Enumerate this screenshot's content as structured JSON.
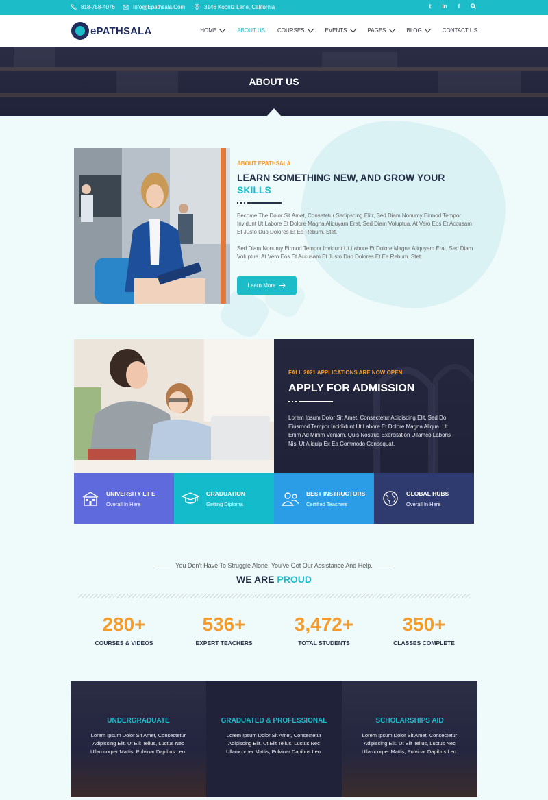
{
  "topbar": {
    "phone": "818-758-4076",
    "email": "Info@Epathsala.Com",
    "address": "3146 Koontz Lane, California",
    "socials": [
      "twitter-icon",
      "linkedin-icon",
      "facebook-icon",
      "search-icon"
    ]
  },
  "header": {
    "logo_text": "ePATHSALA",
    "nav": [
      {
        "label": "HOME",
        "dropdown": true
      },
      {
        "label": "ABOUT US",
        "dropdown": false,
        "active": true
      },
      {
        "label": "COURSES",
        "dropdown": true
      },
      {
        "label": "EVENTS",
        "dropdown": true
      },
      {
        "label": "PAGES",
        "dropdown": true
      },
      {
        "label": "BLOG",
        "dropdown": true
      },
      {
        "label": "CONTACT US",
        "dropdown": false
      }
    ]
  },
  "hero": {
    "title": "ABOUT US"
  },
  "about": {
    "kicker": "ABOUT EPATHSALA",
    "title_main": "LEARN SOMETHING NEW, AND GROW YOUR",
    "title_highlight": "SKILLS",
    "para1": "Become The Dolor Sit Amet, Consetetur Sadipscing Elitr, Sed Diam Nonumy Eirmod Tempor Invidunt Ut Labore Et Dolore Magna Aliquyam Erat, Sed Diam Voluptua. At Vero Eos Et Accusam Et Justo Duo Dolores Et Ea Rebum. Stet.",
    "para2": "Sed Diam Nonumy Eirmod Tempor Invidunt Ut Labore Et Dolore Magna Aliquyam Erat, Sed Diam Voluptua. At Vero Eos Et Accusam Et Justo Duo Dolores Et Ea Rebum. Stet.",
    "button_label": "Learn More"
  },
  "admission": {
    "kicker": "FALL 2021 APPLICATIONS ARE NOW OPEN",
    "title": "APPLY FOR ADMISSION",
    "text": "Lorem Ipsum Dolor Sit Amet, Consectetur Adipiscing Elit, Sed Do Eiusmod Tempor Incididunt Ut Labore Et Dolore Magna Aliqua. Ut Enim Ad Minim Veniam, Quis Nostrud Exercitation Ullamco Laboris Nisi Ut Aliquip Ex Ea Commodo Consequat.",
    "features": [
      {
        "title": "UNIVERSITY LIFE",
        "subtitle": "Overall In Here",
        "icon": "university-icon",
        "color": "#5f6bdc"
      },
      {
        "title": "GRADUATION",
        "subtitle": "Getting Diploma",
        "icon": "graduation-cap-icon",
        "color": "#14bccb"
      },
      {
        "title": "BEST INSTRUCTORS",
        "subtitle": "Certified Teachers",
        "icon": "instructors-icon",
        "color": "#2b9de6"
      },
      {
        "title": "GLOBAL HUBS",
        "subtitle": "Overall In Here",
        "icon": "globe-icon",
        "color": "#2f3a6f"
      }
    ]
  },
  "proud": {
    "subtitle": "You Don't Have To Struggle Alone, You've Got Our Assistance And Help.",
    "title_main": "WE ARE",
    "title_highlight": "PROUD",
    "stats": [
      {
        "number": "280+",
        "label": "COURSES & VIDEOS"
      },
      {
        "number": "536+",
        "label": "EXPERT TEACHERS"
      },
      {
        "number": "3,472+",
        "label": "TOTAL STUDENTS"
      },
      {
        "number": "350+",
        "label": "CLASSES COMPLETE"
      }
    ]
  },
  "programs": [
    {
      "title": "UNDERGRADUATE",
      "text": "Lorem Ipsum Dolor Sit Amet, Consectetur Adipiscing Elit. Ut Elit Tellus, Luctus Nec Ullamcorper Mattis, Pulvinar Dapibus Leo."
    },
    {
      "title": "GRADUATED & PROFESSIONAL",
      "text": "Lorem Ipsum Dolor Sit Amet, Consectetur Adipiscing Elit. Ut Elit Tellus, Luctus Nec Ullamcorper Mattis, Pulvinar Dapibus Leo."
    },
    {
      "title": "SCHOLARSHIPS AID",
      "text": "Lorem Ipsum Dolor Sit Amet, Consectetur Adipiscing Elit. Ut Elit Tellus, Luctus Nec Ullamcorper Mattis, Pulvinar Dapibus Leo."
    }
  ],
  "colors": {
    "accent": "#1dbcc9",
    "orange": "#f39c2c",
    "navy": "#243048",
    "dark": "#20223a"
  }
}
